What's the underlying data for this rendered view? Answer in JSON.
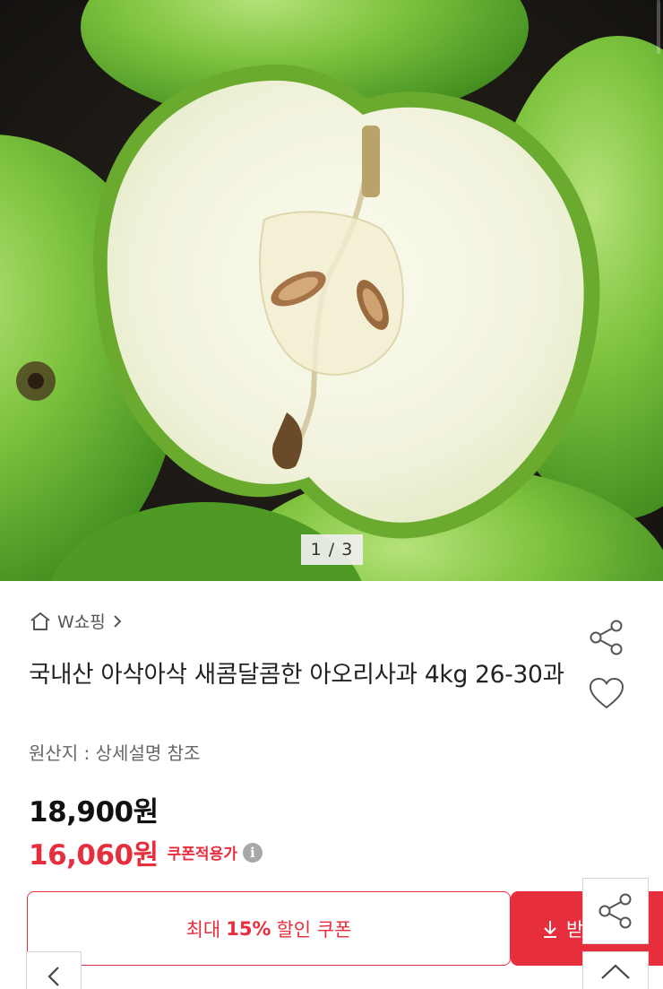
{
  "gallery": {
    "counter": "1 / 3",
    "image_alt": "green apple cut in half"
  },
  "store": {
    "name": "W쇼핑",
    "icon": "home-icon",
    "chevron": "chevron-right-icon"
  },
  "product": {
    "title": "국내산 아삭아삭 새콤달콤한 아오리사과 4kg 26-30과",
    "origin": "원산지 : 상세설명 참조",
    "price_original": "18,900원",
    "price_sale": "16,060원",
    "coupon_applied_label": "쿠폰적용가",
    "info_icon": "i"
  },
  "actions": {
    "coupon_prefix": "최대",
    "coupon_percent": "15%",
    "coupon_suffix": "할인 쿠폰",
    "download_label": "받",
    "share_icon": "share-icon",
    "wishlist_icon": "heart-icon",
    "scroll_top_icon": "chevron-up-icon",
    "back_icon": "chevron-left-icon"
  },
  "colors": {
    "accent_red": "#e62e3d",
    "text_dark": "#222222",
    "text_muted": "#666666"
  }
}
